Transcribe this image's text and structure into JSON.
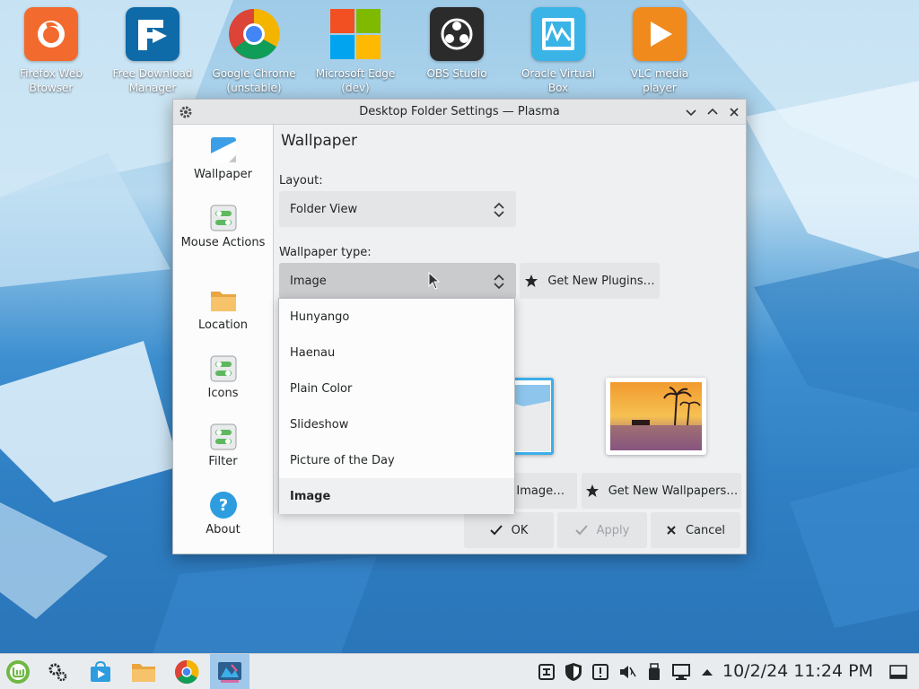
{
  "desktop": {
    "icons": [
      {
        "label": "Firefox Web Browser",
        "icon": "firefox-icon"
      },
      {
        "label": "Free Download Manager",
        "icon": "fdm-icon"
      },
      {
        "label": "Google Chrome (unstable)",
        "icon": "chrome-icon"
      },
      {
        "label": "Microsoft Edge (dev)",
        "icon": "edge-icon"
      },
      {
        "label": "OBS Studio",
        "icon": "obs-icon"
      },
      {
        "label": "Oracle Virtual Box",
        "icon": "virtualbox-icon"
      },
      {
        "label": "VLC media player",
        "icon": "vlc-icon"
      }
    ]
  },
  "dialog": {
    "title": "Desktop Folder Settings — Plasma",
    "sidebar": [
      {
        "label": "Wallpaper",
        "icon": "wallpaper-icon"
      },
      {
        "label": "Mouse Actions",
        "icon": "toggles-icon"
      },
      {
        "label": "Location",
        "icon": "folder-icon"
      },
      {
        "label": "Icons",
        "icon": "toggles-icon"
      },
      {
        "label": "Filter",
        "icon": "toggles-icon"
      },
      {
        "label": "About",
        "icon": "help-icon"
      }
    ],
    "heading": "Wallpaper",
    "layout_label": "Layout:",
    "layout_value": "Folder View",
    "wallpaper_type_label": "Wallpaper type:",
    "wallpaper_type_value": "Image",
    "get_plugins": "Get New Plugins…",
    "add_image": "d Image…",
    "get_wallpapers": "Get New Wallpapers…",
    "ok": "OK",
    "apply": "Apply",
    "cancel": "Cancel",
    "dropdown_options": [
      "Hunyango",
      "Haenau",
      "Plain Color",
      "Slideshow",
      "Picture of the Day",
      "Image"
    ],
    "dropdown_selected": "Image"
  },
  "taskbar": {
    "clock": "10/2/24 11:24 PM",
    "items": [
      "mint-menu-icon",
      "settings-icon",
      "store-icon",
      "files-icon",
      "chrome-icon",
      "plasma-settings-icon"
    ]
  },
  "colors": {
    "accent": "#3daee9",
    "active_task": "#9fc8ea"
  }
}
